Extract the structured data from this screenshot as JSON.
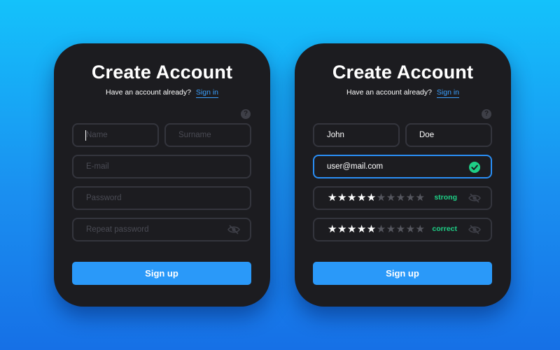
{
  "left_card": {
    "title": "Create Account",
    "subtitle": "Have an account already?",
    "signin_link": "Sign in",
    "help_glyph": "?",
    "fields": {
      "name_placeholder": "Name",
      "surname_placeholder": "Surname",
      "email_placeholder": "E-mail",
      "password_placeholder": "Password",
      "repeat_password_placeholder": "Repeat password"
    },
    "signup_label": "Sign up"
  },
  "right_card": {
    "title": "Create Account",
    "subtitle": "Have an account already?",
    "signin_link": "Sign in",
    "help_glyph": "?",
    "fields": {
      "name_value": "John",
      "surname_value": "Doe",
      "email_value": "user@mail.com",
      "password_stars_filled": "★★★★★",
      "password_stars_empty": "★★★★★",
      "password_strength": "strong",
      "repeat_stars_filled": "★★★★★",
      "repeat_stars_empty": "★★★★★",
      "repeat_status": "correct"
    },
    "signup_label": "Sign up"
  },
  "colors": {
    "accent": "#2a99f9",
    "success": "#1ecf86",
    "card_bg": "#1c1c20",
    "field_border": "#34353d"
  },
  "icons": [
    "help-icon",
    "eye-off-icon",
    "check-circle-icon"
  ]
}
